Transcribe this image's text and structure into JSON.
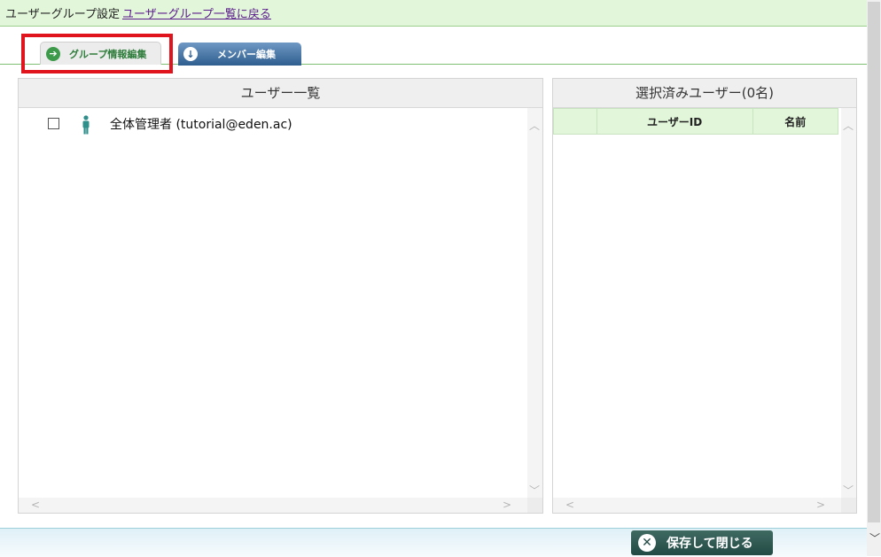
{
  "header": {
    "title": "ユーザーグループ設定",
    "back_link": "ユーザーグループ一覧に戻る"
  },
  "tabs": [
    {
      "label": "グループ情報編集",
      "icon": "arrow-right-circle-icon",
      "state": "active"
    },
    {
      "label": "メンバー編集",
      "icon": "arrow-down-circle-icon",
      "state": "inactive"
    }
  ],
  "user_list": {
    "title": "ユーザー一覧",
    "users": [
      {
        "label": "全体管理者 (tutorial@eden.ac)",
        "checked": false
      }
    ]
  },
  "selected_users": {
    "title": "選択済みユーザー(0名)",
    "columns": [
      "",
      "ユーザーID",
      "名前"
    ],
    "rows": []
  },
  "footer": {
    "save_button": "保存して閉じる"
  },
  "colors": {
    "header_bg": "#e2f7da",
    "highlight": "#e0141c",
    "member_tab": "#2e5e8f",
    "save_button": "#234a44"
  }
}
